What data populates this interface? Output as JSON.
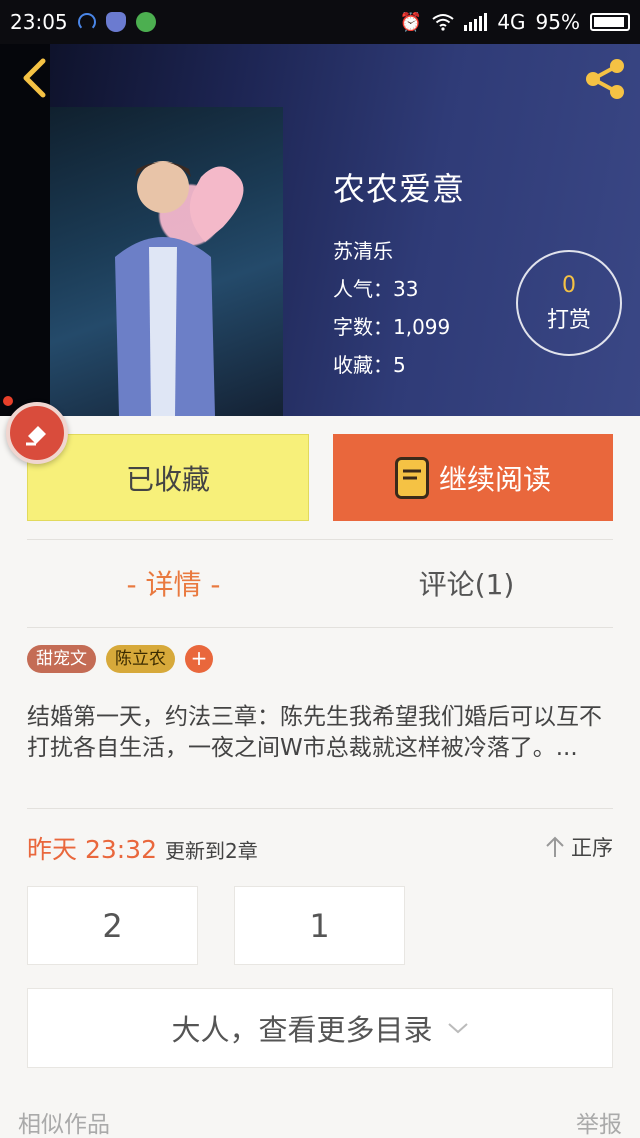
{
  "status_bar": {
    "time": "23:05",
    "network": "4G",
    "battery": "95%"
  },
  "book": {
    "title": "农农爱意",
    "author": "苏清乐",
    "popularity": "人气：33",
    "word_count": "字数：1,099",
    "favorites": "收藏：5"
  },
  "reward": {
    "count": "0",
    "label": "打赏"
  },
  "actions": {
    "collected_label": "已收藏",
    "continue_label": "继续阅读"
  },
  "tabs": {
    "detail": "- 详情 -",
    "comments": "评论(1)"
  },
  "tags": [
    "甜宠文",
    "陈立农",
    "+"
  ],
  "synopsis": "结婚第一天，约法三章：陈先生我希望我们婚后可以互不打扰各自生活，一夜之间W市总裁就这样被冷落了。...",
  "update": {
    "time": "昨天 23:32",
    "text": "更新到2章",
    "sort_label": "正序"
  },
  "chapters": [
    "2",
    "1"
  ],
  "more_catalog": "大人，查看更多目录",
  "footer": {
    "similar": "相似作品",
    "report": "举报"
  },
  "colors": {
    "accent": "#e9673c",
    "collected_bg": "#f7f07a",
    "icon_yellow": "#f5c244"
  }
}
